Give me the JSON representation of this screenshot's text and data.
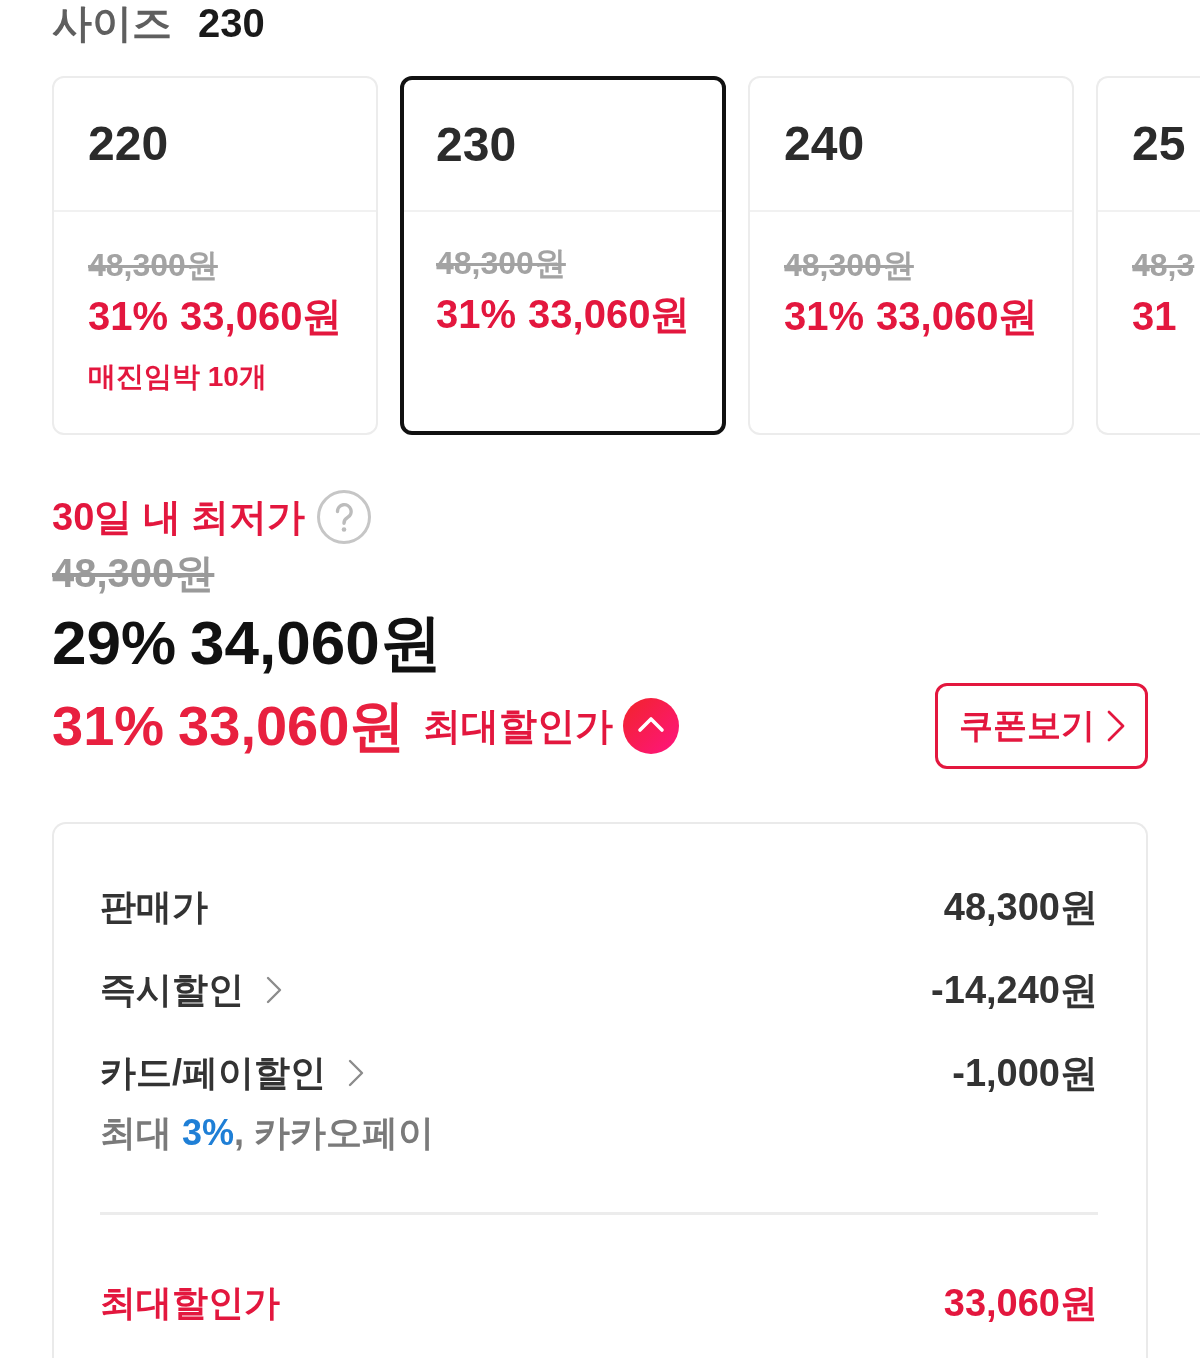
{
  "size_header": {
    "label": "사이즈",
    "value": "230"
  },
  "size_options": [
    {
      "size": "220",
      "original_price": "48,300원",
      "discount": "31%",
      "price": "33,060원",
      "stock_note": "매진임박 10개",
      "selected": false
    },
    {
      "size": "230",
      "original_price": "48,300원",
      "discount": "31%",
      "price": "33,060원",
      "selected": true
    },
    {
      "size": "240",
      "original_price": "48,300원",
      "discount": "31%",
      "price": "33,060원",
      "selected": false
    },
    {
      "size": "25",
      "original_price": "48,3",
      "discount": "31",
      "selected": false
    }
  ],
  "lowest_price": {
    "label": "30일 내 최저가",
    "original_price": "48,300원",
    "discount": "29%",
    "price": "34,060원"
  },
  "max_discount": {
    "discount": "31%",
    "price": "33,060원",
    "label": "최대할인가",
    "expanded": true
  },
  "coupon_button": {
    "label": "쿠폰보기"
  },
  "breakdown": {
    "rows": [
      {
        "kind": "plain",
        "label": "판매가",
        "value": "48,300원"
      },
      {
        "kind": "link",
        "label": "즉시할인",
        "value": "-14,240원"
      },
      {
        "kind": "link",
        "label": "카드/페이할인",
        "value": "-1,000원",
        "note": {
          "prefix": "최대",
          "highlight": "3%",
          "suffix": ", 카카오페이"
        }
      }
    ],
    "total": {
      "label": "최대할인가",
      "value": "33,060원"
    }
  }
}
